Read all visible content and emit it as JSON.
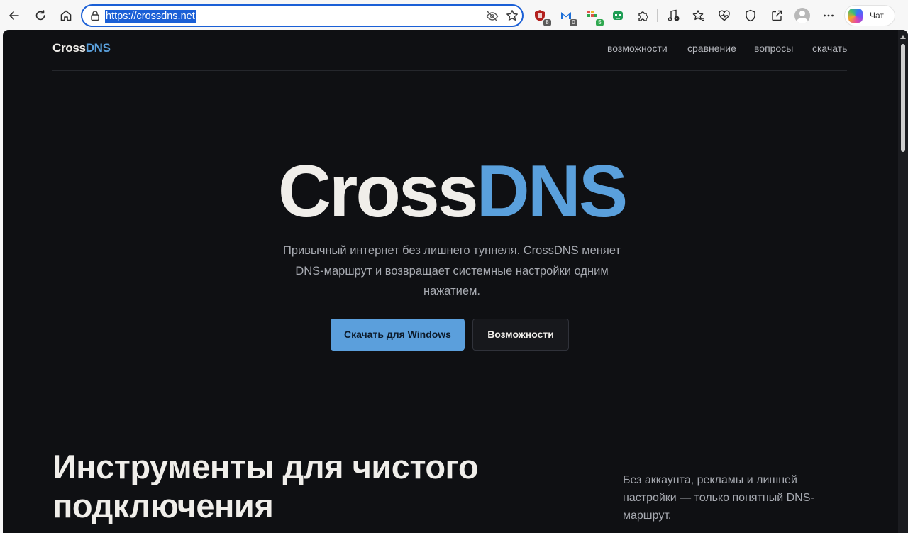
{
  "browser": {
    "address": {
      "url": "https://crossdns.net"
    },
    "copilot_label": "Чат",
    "extension_badges": {
      "ext1": "8",
      "ext2": "0",
      "ext3": "5"
    }
  },
  "page": {
    "brand": {
      "part1": "Cross",
      "part2": "DNS"
    },
    "nav": [
      "возможности",
      "сравнение",
      "вопросы",
      "скачать"
    ],
    "hero": {
      "title_part1": "Cross",
      "title_part2": "DNS",
      "subtitle": "Привычный интернет без лишнего туннеля. CrossDNS меняет DNS-маршрут и возвращает системные настройки одним нажатием.",
      "primary_button": "Скачать для Windows",
      "secondary_button": "Возможности"
    },
    "section": {
      "title": "Инструменты для чистого подключения",
      "subtitle": "Без аккаунта, рекламы и лишней настройки — только понятный DNS-маршрут."
    }
  },
  "colors": {
    "page_background": "#0f1013",
    "accent": "#5aa0dc",
    "text_primary": "#f0eeea",
    "text_muted": "#a7aab1",
    "address_focus": "#1a5fd6"
  }
}
